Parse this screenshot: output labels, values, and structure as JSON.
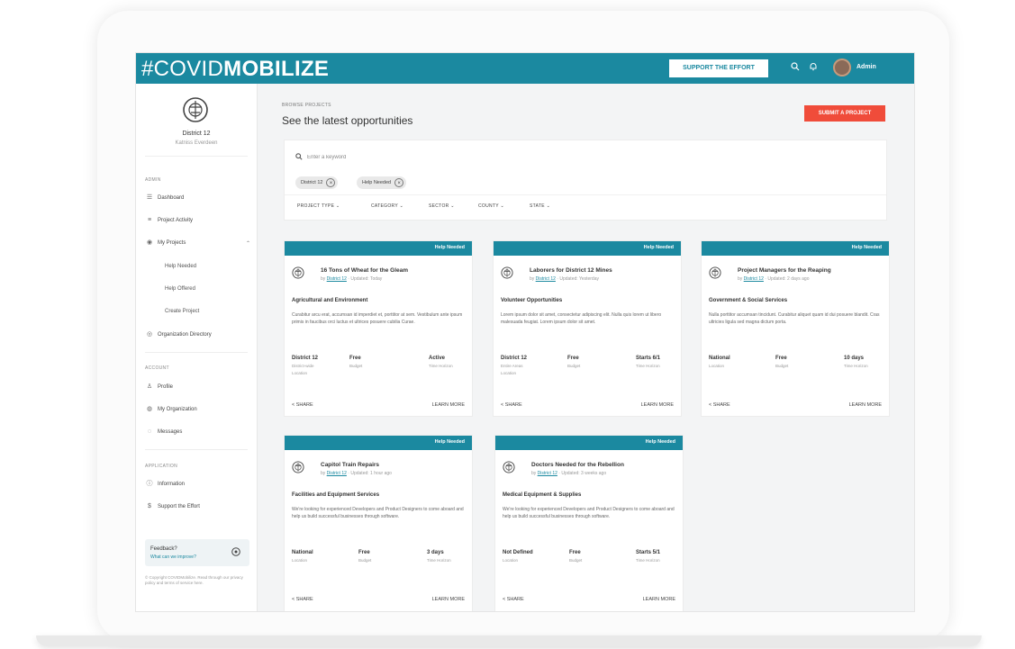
{
  "header": {
    "brand_light": "#COVID",
    "brand_bold": "MOBILIZE",
    "support_label": "SUPPORT THE EFFORT",
    "search_icon": "search-icon",
    "bell_icon": "bell-icon",
    "user_name": "Admin"
  },
  "sidebar": {
    "org_name": "District 12",
    "org_sub": "Katniss Everdeen",
    "sections": {
      "main": "ADMIN",
      "account": "ACCOUNT",
      "application": "APPLICATION"
    },
    "items": {
      "dashboard": "Dashboard",
      "project_activity": "Project Activity",
      "my_projects": "My Projects",
      "help_needed": "Help Needed",
      "help_offered": "Help Offered",
      "create_project": "Create Project",
      "org_directory": "Organization Directory",
      "profile": "Profile",
      "my_organization": "My Organization",
      "messages": "Messages",
      "information": "Information",
      "support_effort": "Support the Effort"
    },
    "feedback_title": "Feedback?",
    "feedback_sub": "What can we improve?",
    "copyright": "© Copyright COVIDMobilize. Read through our privacy policy and terms of service here."
  },
  "main": {
    "breadcrumb": "BROWSE PROJECTS",
    "title": "See the latest opportunities",
    "submit_label": "SUBMIT A PROJECT",
    "search_placeholder": "Enter a keyword",
    "chips": [
      "District 12",
      "Help Needed"
    ],
    "filters": [
      "PROJECT TYPE",
      "CATEGORY",
      "SECTOR",
      "COUNTY",
      "STATE"
    ]
  },
  "cards": [
    {
      "badge": "Help Needed",
      "title": "16 Tons of Wheat for the Gleam",
      "meta_prefix": "by",
      "meta_link": "District 12",
      "meta_suffix": "· Updated: Today",
      "category": "Agricultural and Environment",
      "description": "Curabitur arcu erat, accumsan id imperdiet et, porttitor at sem. Vestibulum ante ipsum primis in faucibus orci luctus et ultrices posuere cubilia Curae.",
      "stats": [
        {
          "value": "District 12",
          "sub": "District-wide",
          "label": "Location"
        },
        {
          "value": "Free",
          "label": "Budget"
        },
        {
          "value": "Active",
          "label": "Time Horizon"
        }
      ],
      "share": "SHARE",
      "learn": "LEARN MORE"
    },
    {
      "badge": "Help Needed",
      "title": "Laborers for District 12 Mines",
      "meta_prefix": "by",
      "meta_link": "District 12",
      "meta_suffix": "· Updated: Yesterday",
      "category": "Volunteer Opportunities",
      "description": "Lorem ipsum dolor sit amet, consectetur adipiscing elit. Nulla quis lorem ut libero malesuada feugiat. Lorem ipsum dolor sit amet.",
      "stats": [
        {
          "value": "District 12",
          "sub": "Entire Areas",
          "label": "Location"
        },
        {
          "value": "Free",
          "label": "Budget"
        },
        {
          "value": "Starts 6/1",
          "label": "Time Horizon"
        }
      ],
      "share": "SHARE",
      "learn": "LEARN MORE"
    },
    {
      "badge": "Help Needed",
      "title": "Project Managers for the Reaping",
      "meta_prefix": "by",
      "meta_link": "District 12",
      "meta_suffix": "· Updated: 2 days ago",
      "category": "Government & Social Services",
      "description": "Nulla porttitor accumsan tincidunt. Curabitur aliquet quam id dui posuere blandit. Cras ultricies ligula sed magna dictum porta.",
      "stats": [
        {
          "value": "National",
          "label": "Location"
        },
        {
          "value": "Free",
          "label": "Budget"
        },
        {
          "value": "10 days",
          "label": "Time Horizon"
        }
      ],
      "share": "SHARE",
      "learn": "LEARN MORE"
    },
    {
      "badge": "Help Needed",
      "title": "Capitol Train Repairs",
      "meta_prefix": "by",
      "meta_link": "District 12",
      "meta_suffix": "· Updated: 1 hour ago",
      "category": "Facilities and Equipment Services",
      "description": "We're looking for experienced Developers and Product Designers to come aboard and help us build successful businesses through software.",
      "stats": [
        {
          "value": "National",
          "label": "Location"
        },
        {
          "value": "Free",
          "label": "Budget"
        },
        {
          "value": "3 days",
          "label": "Time Horizon"
        }
      ],
      "share": "SHARE",
      "learn": "LEARN MORE"
    },
    {
      "badge": "Help Needed",
      "title": "Doctors Needed for the Rebellion",
      "meta_prefix": "by",
      "meta_link": "District 12",
      "meta_suffix": "· Updated: 3 weeks ago",
      "category": "Medical Equipment & Supplies",
      "description": "We're looking for experienced Developers and Product Designers to come aboard and help us build successful businesses through software.",
      "stats": [
        {
          "value": "Not Defined",
          "label": "Location"
        },
        {
          "value": "Free",
          "label": "Budget"
        },
        {
          "value": "Starts 5/1",
          "label": "Time Horizon"
        }
      ],
      "share": "SHARE",
      "learn": "LEARN MORE"
    }
  ],
  "colors": {
    "brand": "#1b89a0",
    "submit": "#f04c3a"
  }
}
